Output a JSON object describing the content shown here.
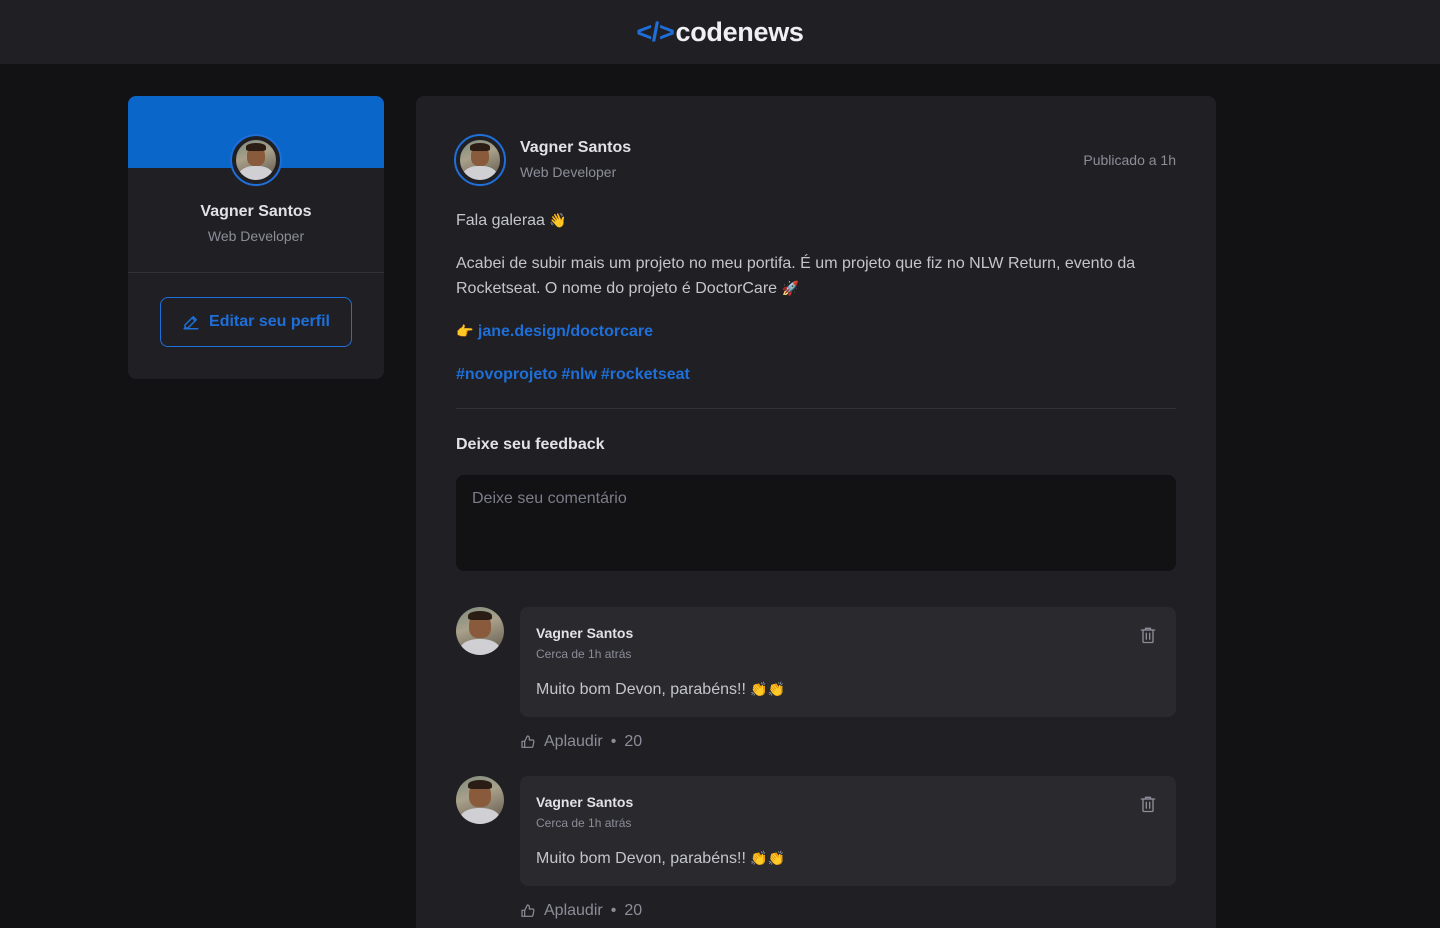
{
  "header": {
    "logo_mark": "</>",
    "logo_text": "codenews"
  },
  "sidebar": {
    "name": "Vagner Santos",
    "role": "Web Developer",
    "edit_label": "Editar seu perfil"
  },
  "post": {
    "author_name": "Vagner Santos",
    "author_role": "Web Developer",
    "published": "Publicado a 1h",
    "greeting": "Fala galeraa",
    "greeting_emoji": "👋",
    "body": "Acabei de subir mais um projeto no meu portifa. É um projeto que fiz no NLW Return, evento da Rocketseat. O nome do projeto é DoctorCare",
    "body_emoji": "🚀",
    "link_emoji": "👉",
    "link": "jane.design/doctorcare",
    "tags": [
      "#novoprojeto",
      "#nlw",
      "#rocketseat"
    ],
    "feedback_title": "Deixe seu feedback",
    "comment_placeholder": "Deixe seu comentário"
  },
  "comments": [
    {
      "name": "Vagner Santos",
      "time": "Cerca de 1h atrás",
      "text": "Muito bom Devon, parabéns!!",
      "emoji": "👏👏",
      "applaud_label": "Aplaudir",
      "applaud_count": "20"
    },
    {
      "name": "Vagner Santos",
      "time": "Cerca de 1h atrás",
      "text": "Muito bom Devon, parabéns!!",
      "emoji": "👏👏",
      "applaud_label": "Aplaudir",
      "applaud_count": "20"
    }
  ],
  "colors": {
    "accent": "#1e6fd9",
    "background": "#121214",
    "surface": "#202024"
  },
  "icons": {
    "edit": "pencil-icon",
    "delete": "trash-icon",
    "applaud": "thumbs-up-icon"
  }
}
